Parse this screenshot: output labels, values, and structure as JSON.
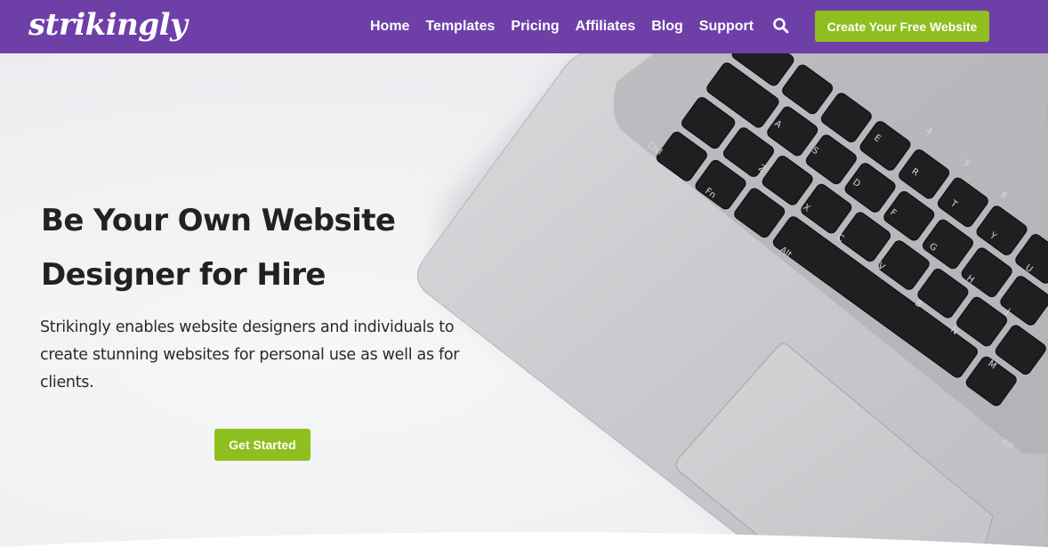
{
  "brand": {
    "logo_text": "strikingly"
  },
  "nav": {
    "items": [
      {
        "label": "Home"
      },
      {
        "label": "Templates"
      },
      {
        "label": "Pricing"
      },
      {
        "label": "Affiliates"
      },
      {
        "label": "Blog"
      },
      {
        "label": "Support"
      }
    ],
    "search_icon": "search-icon",
    "cta_label": "Create Your Free Website"
  },
  "hero": {
    "title_line1": "Be Your Own Website",
    "title_line2": "Designer for Hire",
    "description": "Strikingly enables website designers and individuals to create stunning websites for personal use as well as for clients.",
    "button_label": "Get Started",
    "image": "laptop-keyboard-photo"
  },
  "colors": {
    "nav_bg": "#6f3fa8",
    "accent_green": "#8fbf1f",
    "text_dark": "#222222"
  }
}
